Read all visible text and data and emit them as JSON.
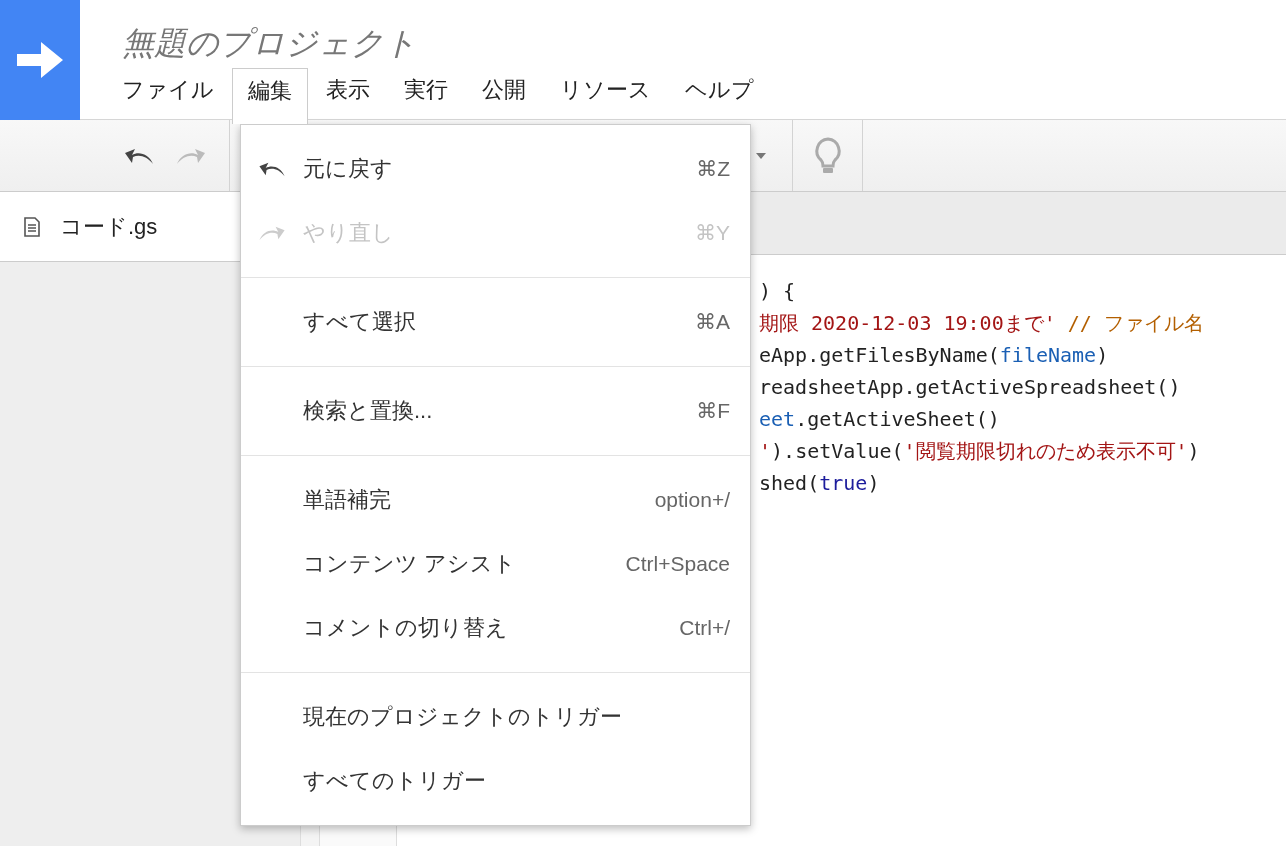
{
  "app": {
    "title": "無題のプロジェクト"
  },
  "menu_bar": [
    {
      "label": "ファイル",
      "selected": false
    },
    {
      "label": "編集",
      "selected": true
    },
    {
      "label": "表示",
      "selected": false
    },
    {
      "label": "実行",
      "selected": false
    },
    {
      "label": "公開",
      "selected": false
    },
    {
      "label": "リソース",
      "selected": false
    },
    {
      "label": "ヘルプ",
      "selected": false
    }
  ],
  "files": [
    {
      "name": "コード.gs",
      "selected": true
    }
  ],
  "code_lines": [
    [
      {
        "text": ") {",
        "kind": "plain"
      }
    ],
    [
      {
        "text": "期限 2020-12-03 19:00まで'",
        "kind": "string"
      },
      {
        "text": "// ファイル名",
        "kind": "comment"
      }
    ],
    [
      {
        "text": "eApp.getFilesByName(",
        "kind": "plain"
      },
      {
        "text": "fileName",
        "kind": "variable"
      },
      {
        "text": ")",
        "kind": "plain"
      }
    ],
    [
      {
        "text": "readsheetApp.getActiveSpreadsheet()",
        "kind": "plain"
      }
    ],
    [
      {
        "text": "eet",
        "kind": "variable"
      },
      {
        "text": ".getActiveSheet()",
        "kind": "plain"
      }
    ],
    [
      {
        "text": "'",
        "kind": "string"
      },
      {
        "text": ").setValue(",
        "kind": "plain"
      },
      {
        "text": "'閲覧期限切れのため表示不可'",
        "kind": "string"
      },
      {
        "text": ")",
        "kind": "plain"
      }
    ],
    [
      {
        "text": "shed(",
        "kind": "plain"
      },
      {
        "text": "true",
        "kind": "keyword"
      },
      {
        "text": ")",
        "kind": "plain"
      }
    ]
  ],
  "edit_menu": {
    "sections": [
      {
        "items": [
          {
            "label": "元に戻す",
            "shortcut": "⌘Z",
            "kind": "undo",
            "disabled": false
          },
          {
            "label": "やり直し",
            "shortcut": "⌘Y",
            "kind": "redo",
            "disabled": true
          }
        ]
      },
      {
        "items": [
          {
            "label": "すべて選択",
            "shortcut": "⌘A",
            "kind": "plain",
            "disabled": false
          }
        ]
      },
      {
        "items": [
          {
            "label": "検索と置換...",
            "shortcut": "⌘F",
            "kind": "plain",
            "disabled": false
          }
        ]
      },
      {
        "items": [
          {
            "label": "単語補完",
            "shortcut": "option+/",
            "kind": "plain",
            "disabled": false
          },
          {
            "label": "コンテンツ アシスト",
            "shortcut": "Ctrl+Space",
            "kind": "plain",
            "disabled": false
          },
          {
            "label": "コメントの切り替え",
            "shortcut": "Ctrl+/",
            "kind": "plain",
            "disabled": false
          }
        ]
      },
      {
        "items": [
          {
            "label": "現在のプロジェクトのトリガー",
            "kind": "plain",
            "disabled": false
          },
          {
            "label": "すべてのトリガー",
            "kind": "plain",
            "disabled": false
          }
        ]
      }
    ]
  }
}
